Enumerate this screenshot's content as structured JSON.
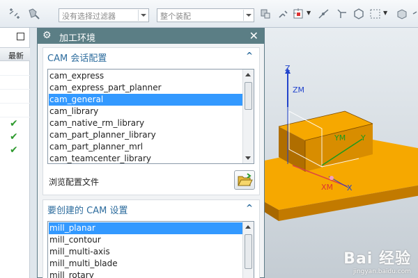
{
  "toolbar": {
    "filter_placeholder": "没有选择过滤器",
    "scope_value": "整个装配"
  },
  "navigator": {
    "column_header": "最新",
    "checks": [
      "✔",
      "✔",
      "✔"
    ]
  },
  "dialog": {
    "title": "加工环境",
    "session_section": {
      "label": "CAM 会话配置",
      "items": [
        "cam_express",
        "cam_express_part_planner",
        "cam_general",
        "cam_library",
        "cam_native_rm_library",
        "cam_part_planner_library",
        "cam_part_planner_mrl",
        "cam_teamcenter_library"
      ],
      "selected": "cam_general"
    },
    "browse_label": "浏览配置文件",
    "setup_section": {
      "label": "要创建的 CAM 设置",
      "items": [
        "mill_planar",
        "mill_contour",
        "mill_multi-axis",
        "mill_multi_blade",
        "mill_rotary"
      ],
      "selected": "mill_planar"
    }
  },
  "viewport": {
    "axis_labels": {
      "z": "Z",
      "zm": "ZM",
      "ym": "YM",
      "y": "Y",
      "xm": "XM",
      "x": "X"
    },
    "colors": {
      "part": "#f6a800",
      "part_dark": "#b56f00",
      "background": "#dfe6ec"
    }
  },
  "watermark": {
    "brand": "Bai 经验",
    "url": "jingyan.baidu.com"
  }
}
